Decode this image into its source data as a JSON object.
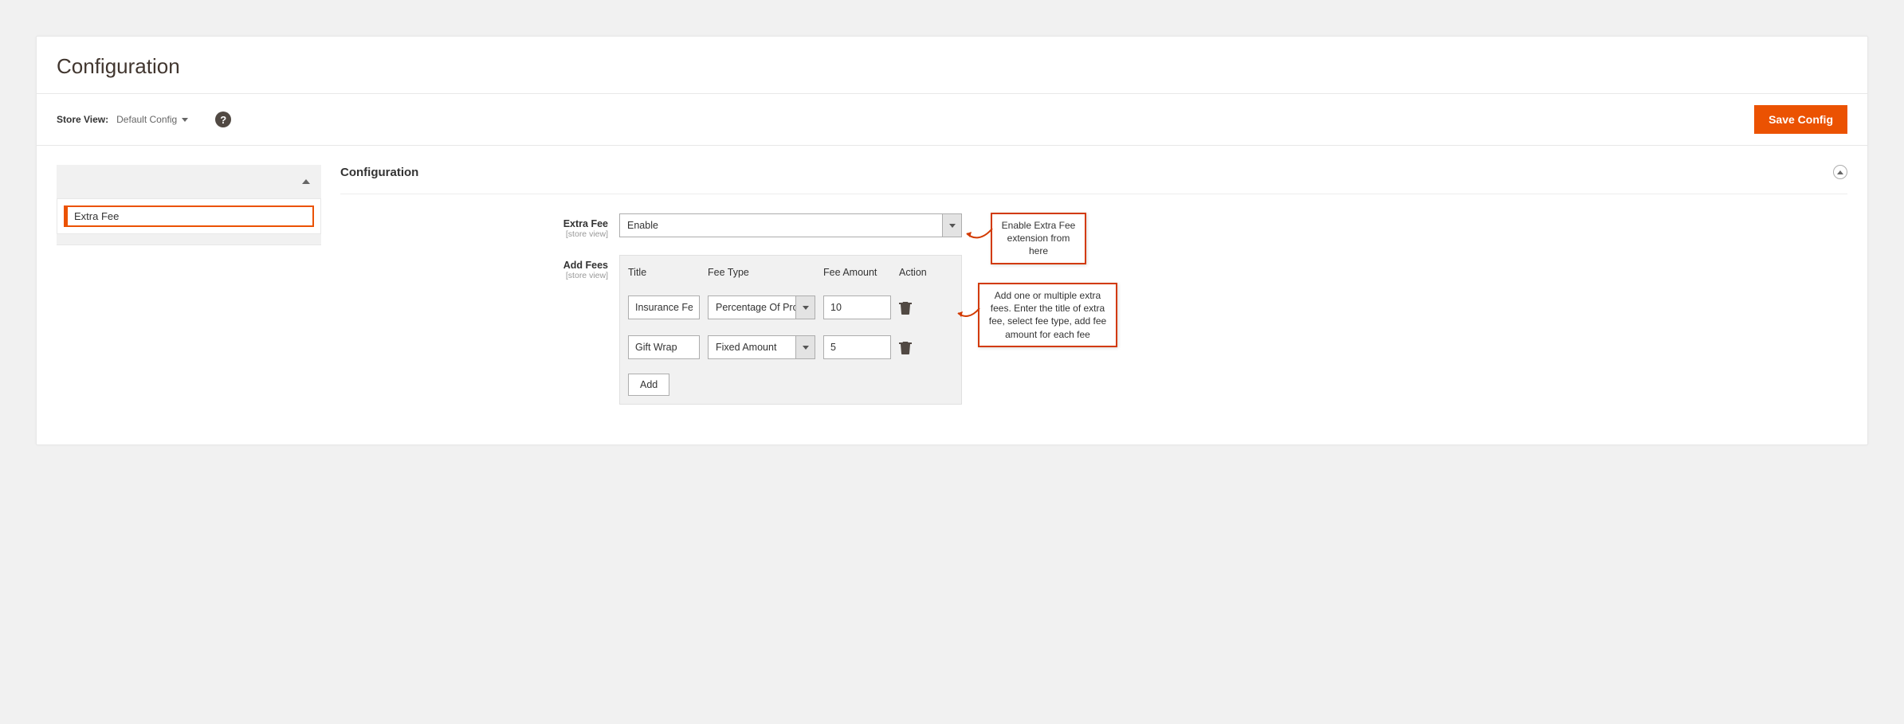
{
  "page": {
    "title": "Configuration"
  },
  "topbar": {
    "store_view_label": "Store View:",
    "store_view_value": "Default Config",
    "help_symbol": "?",
    "save_button": "Save Config"
  },
  "sidebar": {
    "items": [
      {
        "label": "Extra Fee"
      }
    ]
  },
  "section": {
    "title": "Configuration"
  },
  "fields": {
    "extra_fee": {
      "label": "Extra Fee",
      "scope": "[store view]",
      "value": "Enable"
    },
    "add_fees": {
      "label": "Add Fees",
      "scope": "[store view]",
      "columns": {
        "title": "Title",
        "type": "Fee Type",
        "amount": "Fee Amount",
        "action": "Action"
      },
      "rows": [
        {
          "title": "Insurance Fees",
          "type": "Percentage Of Proc",
          "amount": "10"
        },
        {
          "title": "Gift Wrap",
          "type": "Fixed Amount",
          "amount": "5"
        }
      ],
      "add_button": "Add"
    }
  },
  "callouts": {
    "enable": "Enable Extra Fee extension from here",
    "add_fees": "Add one or multiple extra fees. Enter the title of extra fee, select fee type, add fee amount for each fee"
  }
}
